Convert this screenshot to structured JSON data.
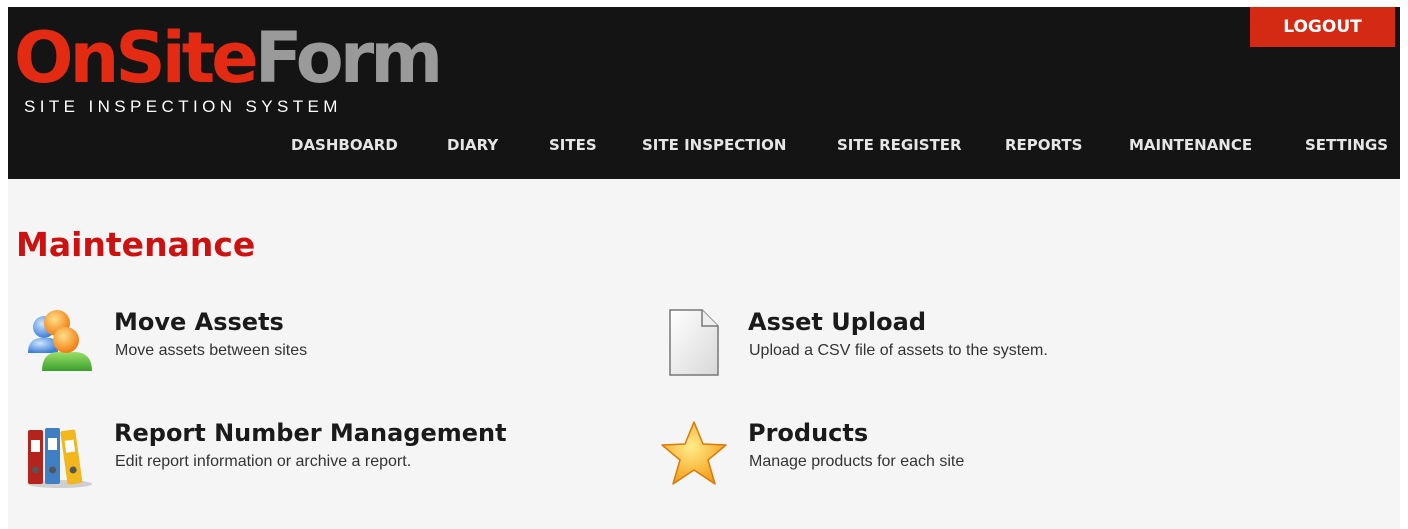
{
  "brand": {
    "logo_on_site": "OnSite",
    "logo_form": "Form",
    "tagline": "SITE INSPECTION SYSTEM",
    "primary_color": "#e32b14",
    "secondary_color": "#9a9a9a"
  },
  "header": {
    "logout_label": "LOGOUT",
    "nav": [
      {
        "label": "DASHBOARD"
      },
      {
        "label": "DIARY"
      },
      {
        "label": "SITES"
      },
      {
        "label": "SITE INSPECTION"
      },
      {
        "label": "SITE REGISTER"
      },
      {
        "label": "REPORTS"
      },
      {
        "label": "MAINTENANCE"
      },
      {
        "label": "SETTINGS"
      }
    ]
  },
  "page": {
    "title": "Maintenance",
    "title_color": "#cc1111"
  },
  "tiles": [
    {
      "title": "Move Assets",
      "description": "Move assets between sites",
      "icon": "users-icon"
    },
    {
      "title": "Asset Upload",
      "description": "Upload a CSV file of assets to the system.",
      "icon": "document-icon"
    },
    {
      "title": "Report Number Management",
      "description": "Edit report information or archive a report.",
      "icon": "binders-icon"
    },
    {
      "title": "Products",
      "description": "Manage products for each site",
      "icon": "star-icon"
    }
  ]
}
